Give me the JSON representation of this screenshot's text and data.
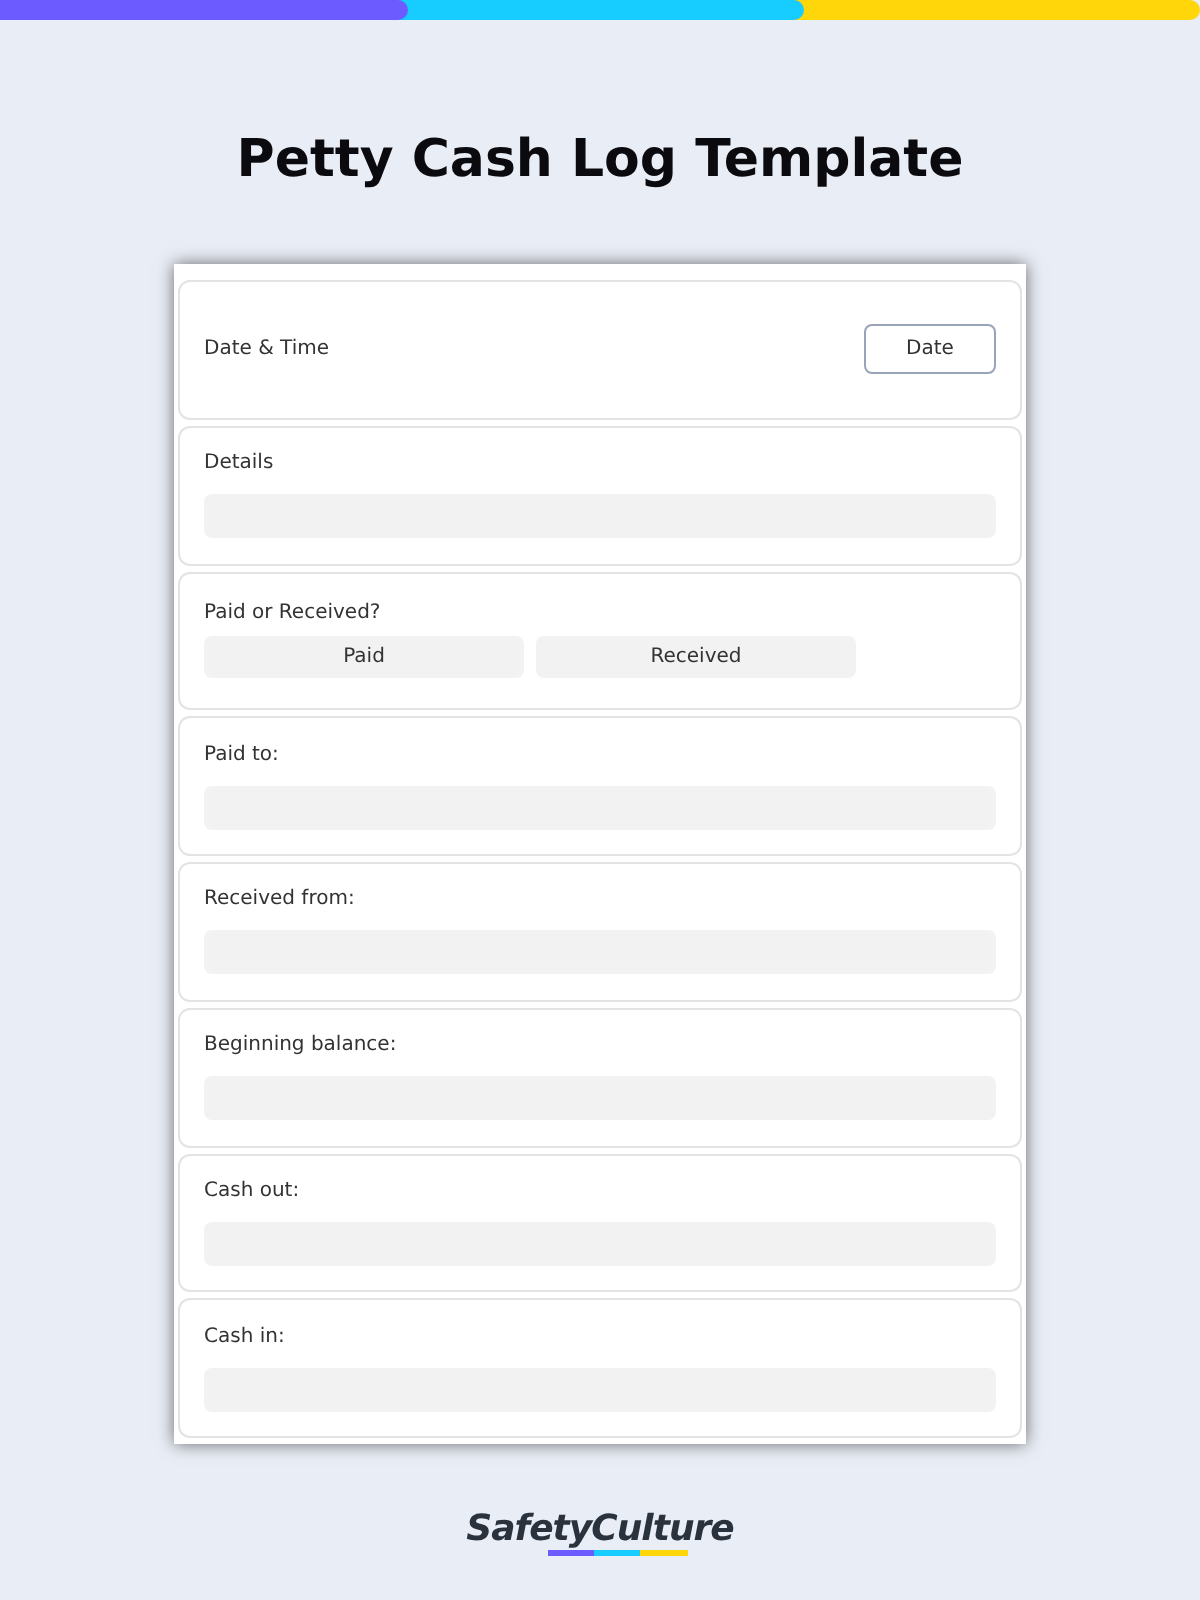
{
  "title": "Petty Cash Log Template",
  "form": {
    "items": [
      {
        "kind": "date",
        "label": "Date & Time",
        "button": "Date"
      },
      {
        "kind": "text",
        "label": "Details"
      },
      {
        "kind": "choice",
        "label": "Paid or Received?",
        "options": [
          {
            "label": "Paid",
            "selected": false
          },
          {
            "label": "Received",
            "selected": false
          }
        ]
      },
      {
        "kind": "text",
        "label": "Paid to:"
      },
      {
        "kind": "text",
        "label": "Received from:"
      },
      {
        "kind": "text",
        "label": "Beginning balance:"
      },
      {
        "kind": "text",
        "label": "Cash out:"
      },
      {
        "kind": "text",
        "label": "Cash in:"
      }
    ]
  },
  "logo": "SafetyCulture"
}
